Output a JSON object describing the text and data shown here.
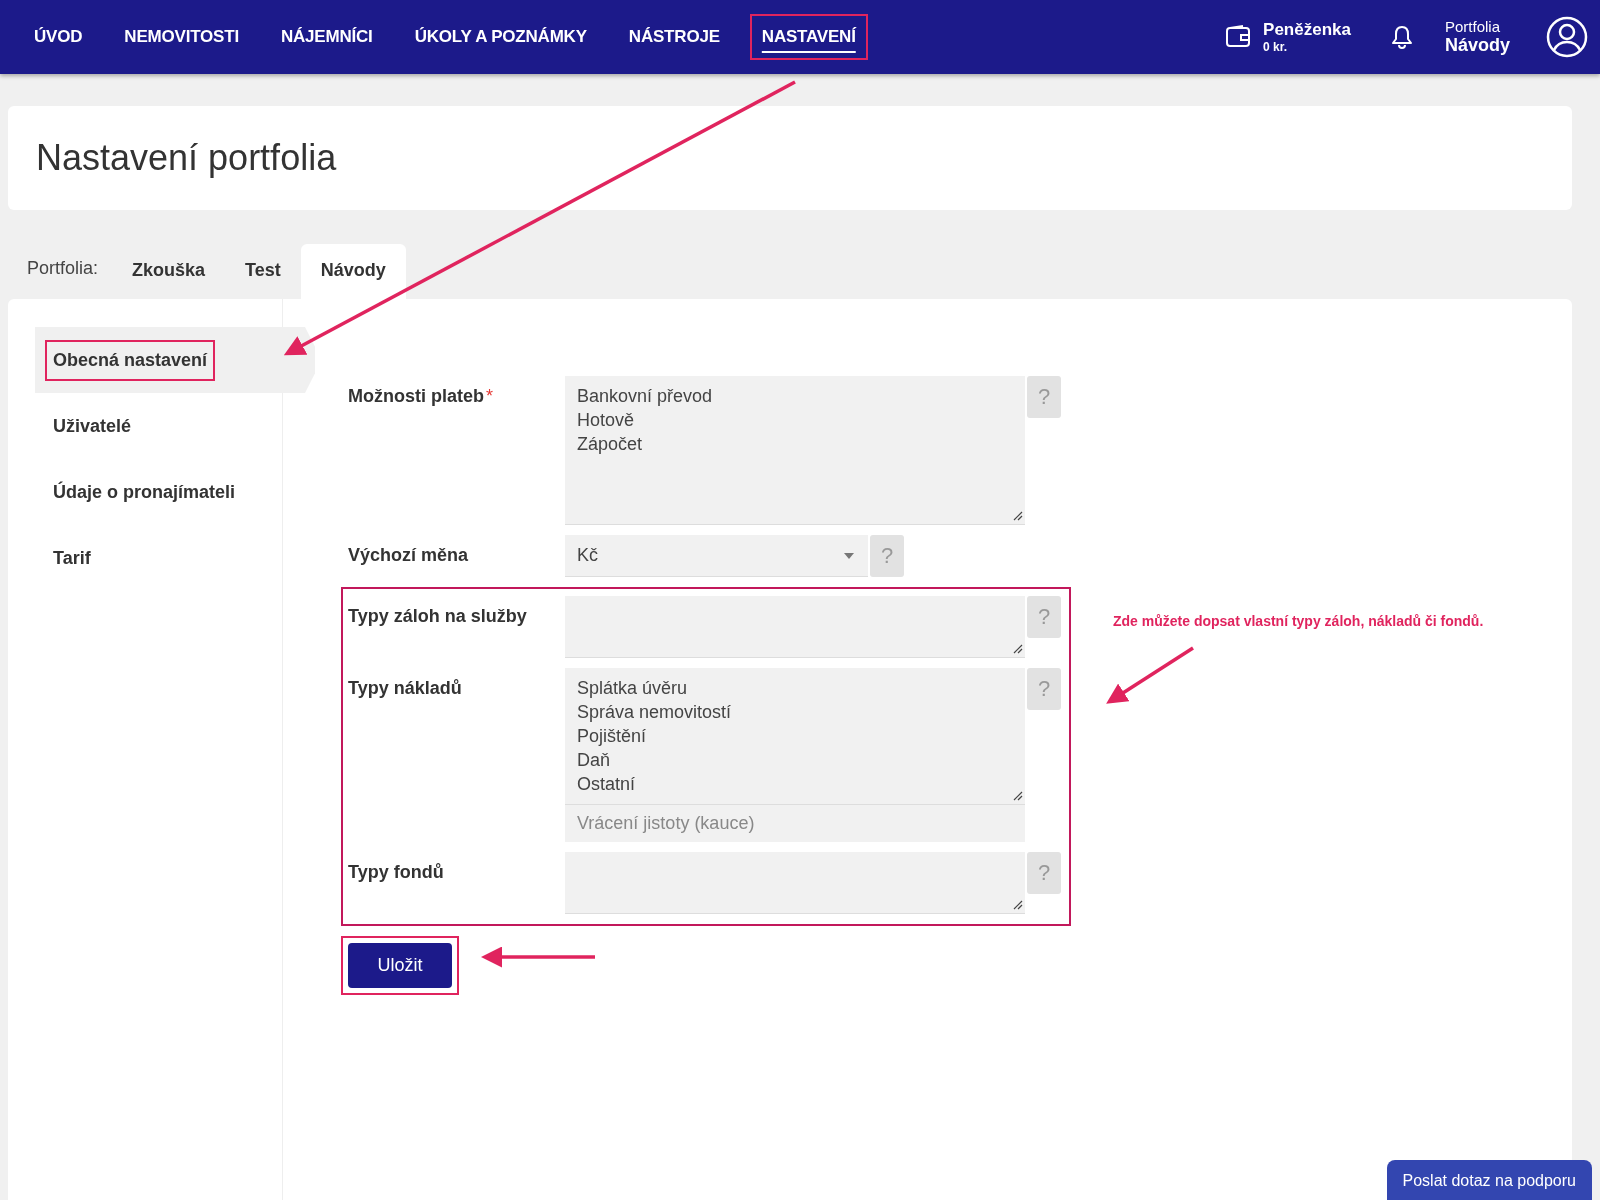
{
  "nav": {
    "items": [
      {
        "label": "ÚVOD",
        "selected": false,
        "highlighted": false
      },
      {
        "label": "NEMOVITOSTI",
        "selected": false,
        "highlighted": false
      },
      {
        "label": "NÁJEMNÍCI",
        "selected": false,
        "highlighted": false
      },
      {
        "label": "ÚKOLY A POZNÁMKY",
        "selected": false,
        "highlighted": false
      },
      {
        "label": "NÁSTROJE",
        "selected": false,
        "highlighted": false
      },
      {
        "label": "NASTAVENÍ",
        "selected": true,
        "highlighted": true
      }
    ],
    "wallet": {
      "title": "Peněženka",
      "amount": "0 kr."
    },
    "portfolio": {
      "caption": "Portfolia",
      "name": "Návody"
    }
  },
  "page_title": "Nastavení portfolia",
  "portfolio_tabs": {
    "label": "Portfolia:",
    "tabs": [
      {
        "label": "Zkouška",
        "selected": false
      },
      {
        "label": "Test",
        "selected": false
      },
      {
        "label": "Návody",
        "selected": true
      }
    ]
  },
  "sidebar": {
    "items": [
      {
        "label": "Obecná nastavení",
        "selected": true,
        "highlighted": true
      },
      {
        "label": "Uživatelé",
        "selected": false,
        "highlighted": false
      },
      {
        "label": "Údaje o pronajímateli",
        "selected": false,
        "highlighted": false
      },
      {
        "label": "Tarif",
        "selected": false,
        "highlighted": false
      }
    ]
  },
  "form": {
    "fields": [
      {
        "kind": "textarea",
        "label": "Možnosti plateb",
        "required_mark": "*",
        "lines": [
          "Bankovní převod",
          "Hotově",
          "Zápočet"
        ],
        "help": "?"
      },
      {
        "kind": "select",
        "label": "Výchozí měna",
        "value": "Kč",
        "help": "?"
      }
    ],
    "highlighted_group": {
      "fields": [
        {
          "kind": "textarea",
          "label": "Typy záloh na služby",
          "help": "?"
        },
        {
          "kind": "textarea",
          "label": "Typy nákladů",
          "lines": [
            "Splátka úvěru",
            "Správa nemovitostí",
            "Pojištění",
            "Daň",
            "Ostatní"
          ],
          "extra_input": {
            "placeholder": "Vrácení jistoty (kauce)"
          },
          "help": "?"
        },
        {
          "kind": "textarea",
          "label": "Typy fondů",
          "help": "?"
        }
      ]
    },
    "save_button": {
      "label": "Uložit",
      "highlighted": true
    }
  },
  "annotation": {
    "note": "Zde můžete dopsat vlastní typy záloh, nákladů či fondů."
  },
  "support_button": {
    "label": "Poslat dotaz na podporu"
  }
}
